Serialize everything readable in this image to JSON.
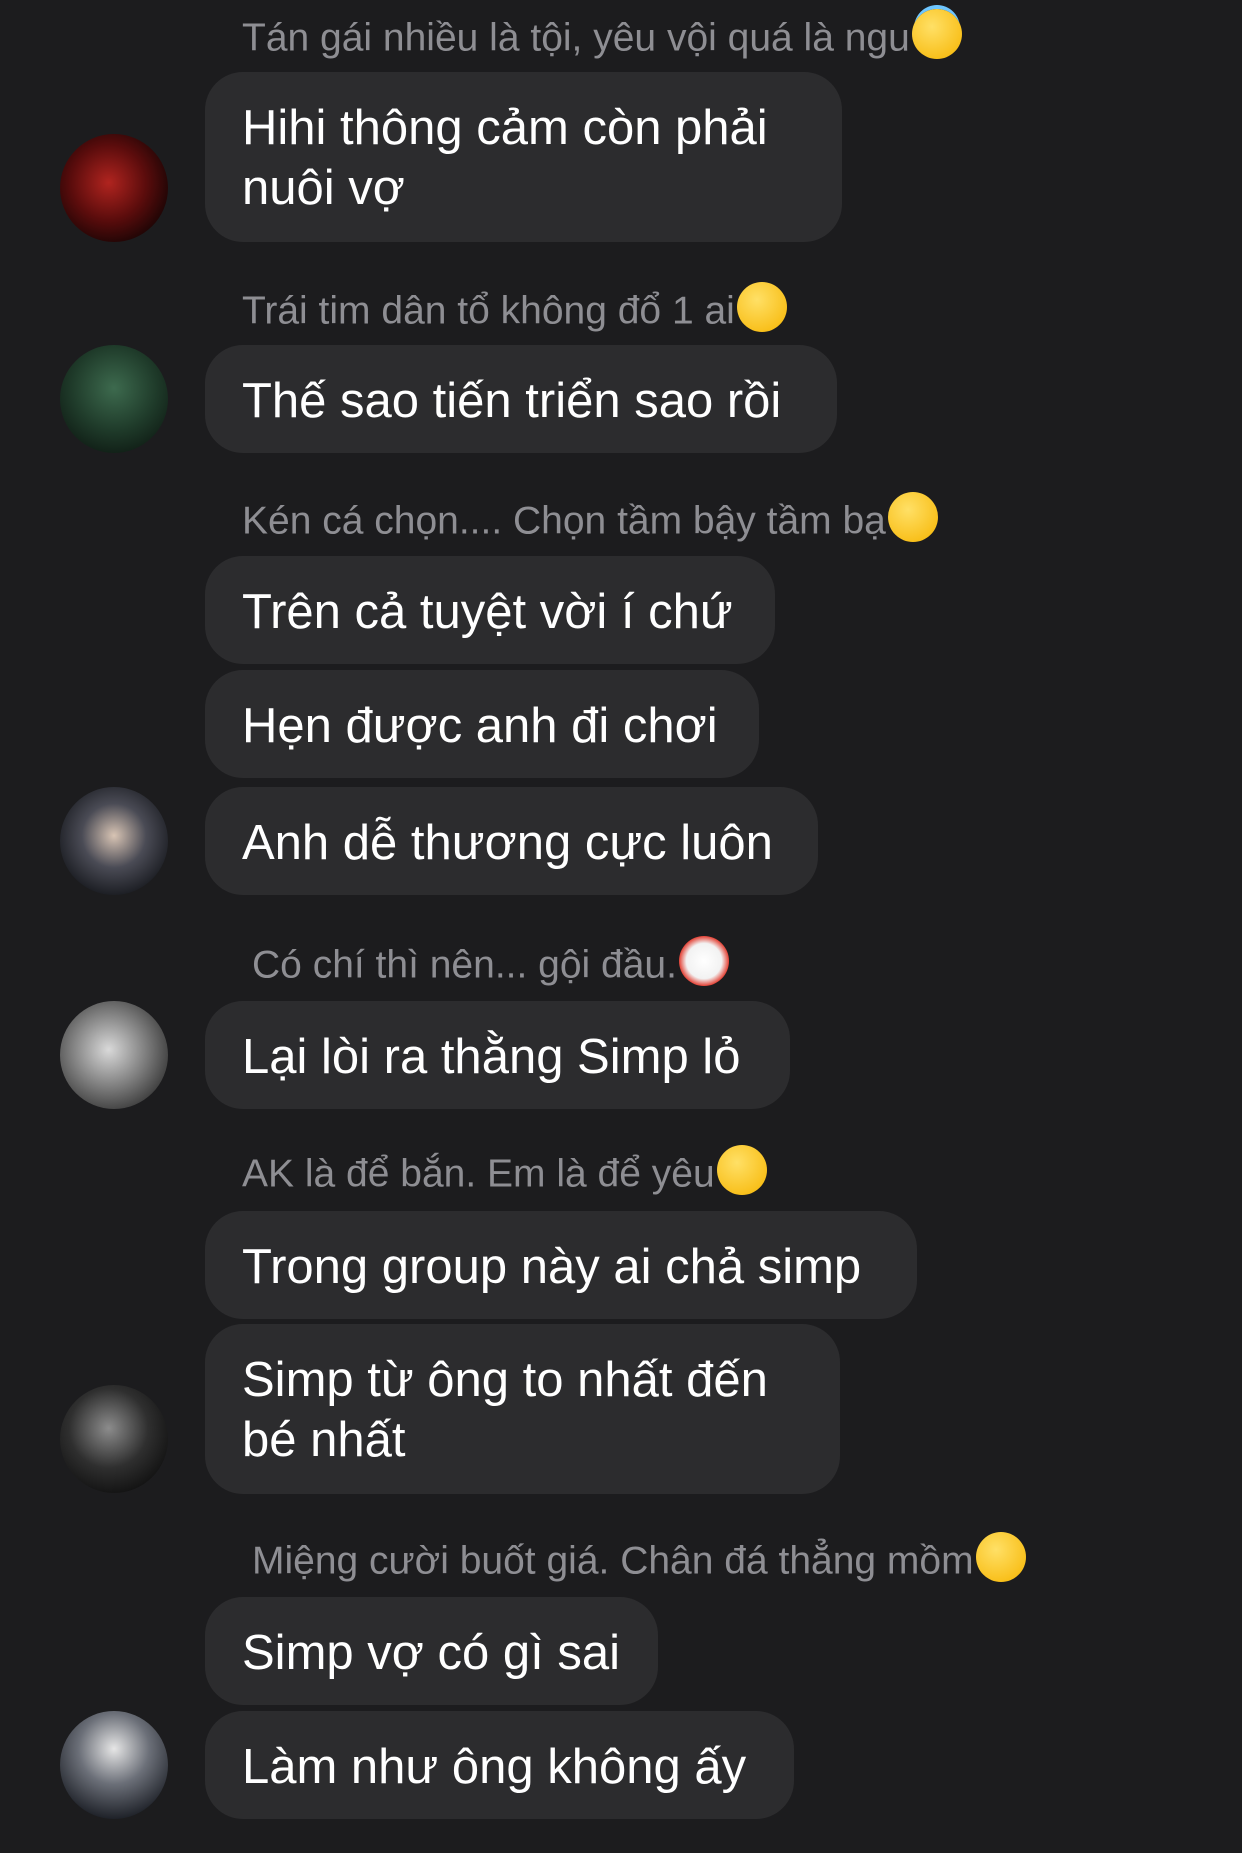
{
  "messages": [
    {
      "nickname": "Tán gái nhiều là tội, yêu vội quá là ngu",
      "emoji": "smiling-face-with-halo-emoji",
      "bubbles": [
        "Hihi thông cảm còn phải nuôi vợ"
      ]
    },
    {
      "nickname": "Trái tim dân tổ không đổ 1 ai",
      "emoji": "winking-face-with-tongue-emoji",
      "bubbles": [
        "Thế sao tiến triển sao rồi"
      ]
    },
    {
      "nickname": "Kén cá chọn.... Chọn tầm bậy tầm bạ",
      "emoji": "expressionless-face-emoji",
      "bubbles": [
        "Trên cả tuyệt vời í chứ",
        "Hẹn được anh đi chơi",
        "Anh dễ thương cực luôn"
      ]
    },
    {
      "nickname": "Có chí thì nên... gội đầu.",
      "emoji": "clown-face-emoji",
      "bubbles": [
        "Lại lòi ra thằng Simp lỏ"
      ]
    },
    {
      "nickname": "AK là để bắn. Em là để yêu",
      "emoji": "face-with-hand-over-mouth-emoji",
      "bubbles": [
        "Trong group này ai chả simp",
        "Simp từ ông to nhất đến bé nhất"
      ]
    },
    {
      "nickname": "Miệng cười buốt giá. Chân đá thẳng mồm",
      "emoji": "winking-face-with-tongue-emoji",
      "bubbles": [
        "Simp vợ có gì sai",
        "Làm như ông không ấy"
      ]
    }
  ]
}
